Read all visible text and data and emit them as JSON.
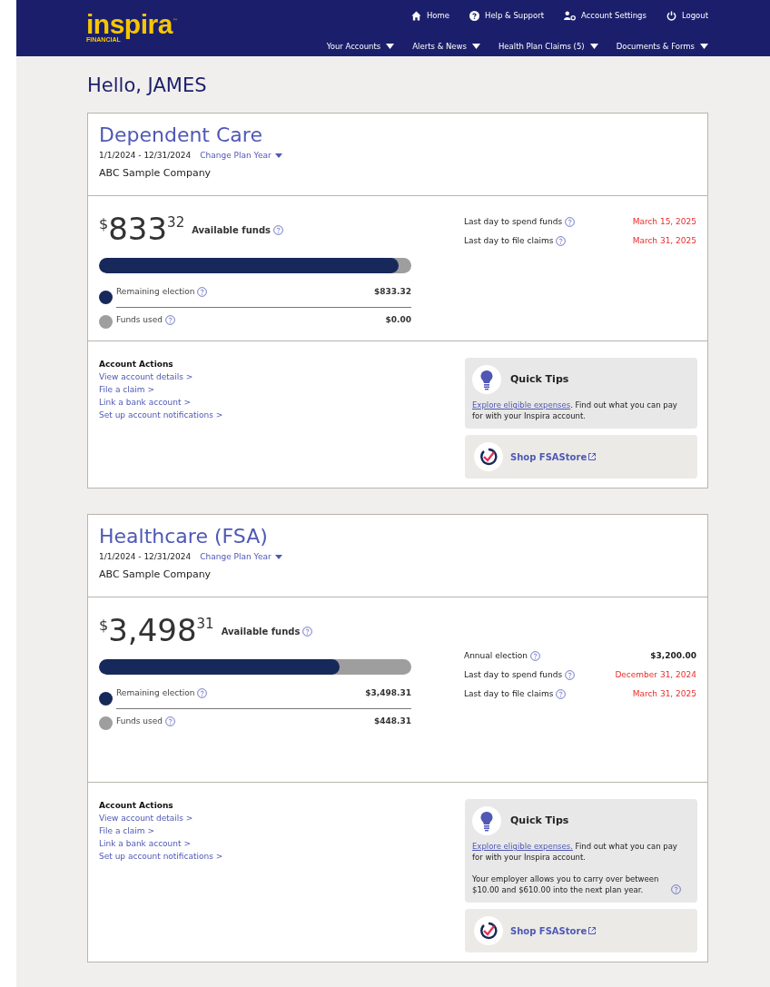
{
  "header": {
    "logo": "inspira",
    "logo_mark": "™",
    "logo_sub": "FINANCIAL",
    "top_links": [
      {
        "label": "Home",
        "kind": "home"
      },
      {
        "label": "Help & Support",
        "kind": "help"
      },
      {
        "label": "Account Settings",
        "kind": "settings"
      },
      {
        "label": "Logout",
        "kind": "logout"
      }
    ],
    "nav": [
      "Your Accounts",
      "Alerts & News",
      "Health Plan Claims (5)",
      "Documents & Forms"
    ]
  },
  "greeting": "Hello, JAMES",
  "accounts": [
    {
      "title": "Dependent Care",
      "dates": "1/1/2024 - 12/31/2024",
      "change_plan_year": "Change Plan Year",
      "company": "ABC Sample Company",
      "balance": {
        "currency": "$",
        "whole": "833",
        "cents": "32",
        "label": "Available funds"
      },
      "level": 0.96,
      "legend": [
        {
          "kind": "remaining",
          "label": "Remaining election",
          "value": "$833.32"
        },
        {
          "kind": "used",
          "label": "Funds used",
          "value": "$0.00"
        }
      ],
      "details": [
        {
          "kind": "date",
          "label": "Last day to spend funds",
          "value": "March 15, 2025"
        },
        {
          "kind": "date",
          "label": "Last day to file claims",
          "value": "March 31, 2025"
        }
      ],
      "actions_title": "Account Actions",
      "actions": [
        "View account details >",
        "File a claim >",
        "Link a bank account >",
        "Set up account notifications >"
      ],
      "tips": {
        "title": "Quick Tips",
        "link": "Explore eligible expenses",
        "text": ". Find out what you can pay for with your Inspira account."
      },
      "shop": "Shop FSAStore"
    },
    {
      "title": "Healthcare (FSA)",
      "dates": "1/1/2024 - 12/31/2024",
      "change_plan_year": "Change Plan Year",
      "company": "ABC Sample Company",
      "balance": {
        "currency": "$",
        "whole": "3,498",
        "cents": "31",
        "label": "Available funds"
      },
      "level": 0.77,
      "legend": [
        {
          "kind": "remaining",
          "label": "Remaining election",
          "value": "$3,498.31"
        },
        {
          "kind": "used",
          "label": "Funds used",
          "value": "$448.31"
        }
      ],
      "details": [
        {
          "kind": "amount",
          "label": "Annual election",
          "value": "$3,200.00"
        },
        {
          "kind": "date",
          "label": "Last day to spend funds",
          "value": "December 31, 2024"
        },
        {
          "kind": "date",
          "label": "Last day to file claims",
          "value": "March 31, 2025"
        }
      ],
      "actions_title": "Account Actions",
      "actions": [
        "View account details >",
        "File a claim >",
        "Link a bank account >",
        "Set up account notifications >"
      ],
      "tips": {
        "title": "Quick Tips",
        "link": "Explore eligible expenses.",
        "text": " Find out what you can pay for with your Inspira account.",
        "note": "Your employer allows you to carry over between $10.00 and $610.00 into the next plan year."
      },
      "shop": "Shop FSAStore"
    }
  ]
}
